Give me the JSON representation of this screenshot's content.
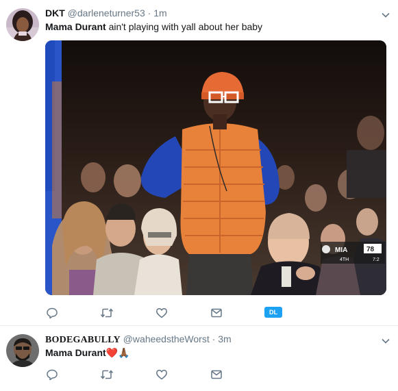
{
  "tweets": [
    {
      "display_name": "DKT",
      "handle": "@darleneturner53",
      "separator": "·",
      "time": "1m",
      "text_bold": "Mama Durant",
      "text_rest": " ain't playing with yall about her baby",
      "media": {
        "scoreboard_team": "MIA",
        "scoreboard_score": "78",
        "scoreboard_period": "4TH",
        "scoreboard_clock": "7:2"
      },
      "actions": [
        "reply-icon",
        "retweet-icon",
        "like-icon",
        "message-icon"
      ],
      "badge_label": "DL",
      "accent_color": "#1da1f2"
    },
    {
      "display_name": "BODEGABULLY",
      "handle": "@waheedstheWorst",
      "separator": "·",
      "time": "3m",
      "text_bold": "Mama Durant",
      "emoji": "❤️🙏🏾",
      "actions": [
        "reply-icon",
        "retweet-icon",
        "like-icon",
        "message-icon"
      ]
    }
  ]
}
